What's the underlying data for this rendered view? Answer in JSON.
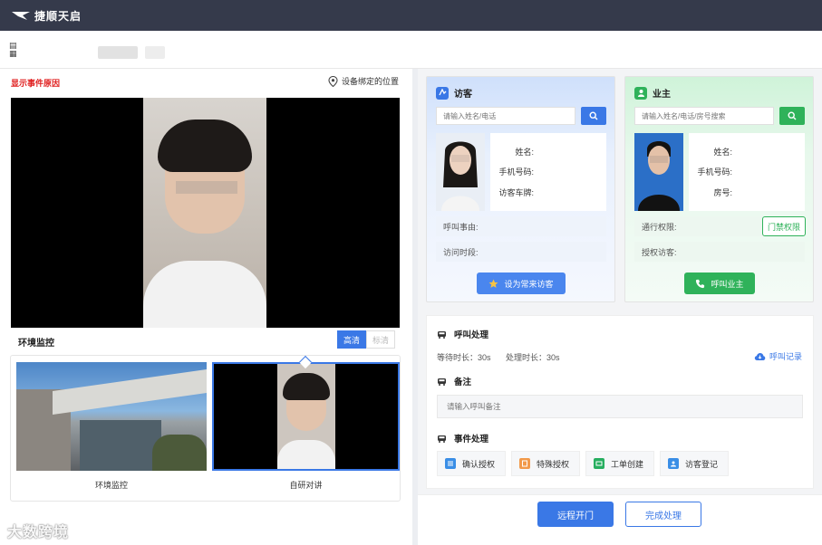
{
  "app": {
    "brand": "捷顺天启"
  },
  "subheader": {
    "icon_text": "图片"
  },
  "left": {
    "event_reason": "显示事件原因",
    "bind_location": "设备绑定的位置",
    "env_label": "环境监控",
    "quality": {
      "hd": "高清",
      "sd": "标清"
    },
    "thumbs": [
      {
        "caption": "环境监控"
      },
      {
        "caption": "自研对讲"
      }
    ]
  },
  "visitor": {
    "title": "访客",
    "search_placeholder": "请输入姓名/电话",
    "fields": {
      "name": "姓名:",
      "phone": "手机号码:",
      "plate": "访客车牌:"
    },
    "reason_label": "呼叫事由:",
    "time_label": "访问时段:",
    "action": "设为常来访客"
  },
  "owner": {
    "title": "业主",
    "search_placeholder": "请输入姓名/电话/房号搜索",
    "fields": {
      "name": "姓名:",
      "phone": "手机号码:",
      "room": "房号:"
    },
    "access_label": "通行权限:",
    "perm_button": "门禁权限",
    "auth_label": "授权访客:",
    "action": "呼叫业主"
  },
  "process": {
    "call_title": "呼叫处理",
    "wait_label": "等待时长：30s",
    "handle_label": "处理时长：30s",
    "call_record": "呼叫记录",
    "note_title": "备注",
    "note_placeholder": "请输入呼叫备注",
    "event_title": "事件处理",
    "events": [
      "确认授权",
      "特殊授权",
      "工单创建",
      "访客登记"
    ]
  },
  "footer": {
    "open": "远程开门",
    "done": "完成处理"
  },
  "watermark": "大数跨境",
  "colors": {
    "primary": "#3a78e6",
    "success": "#2fb25a",
    "alert": "#e02020",
    "topbar": "#353a4b"
  }
}
